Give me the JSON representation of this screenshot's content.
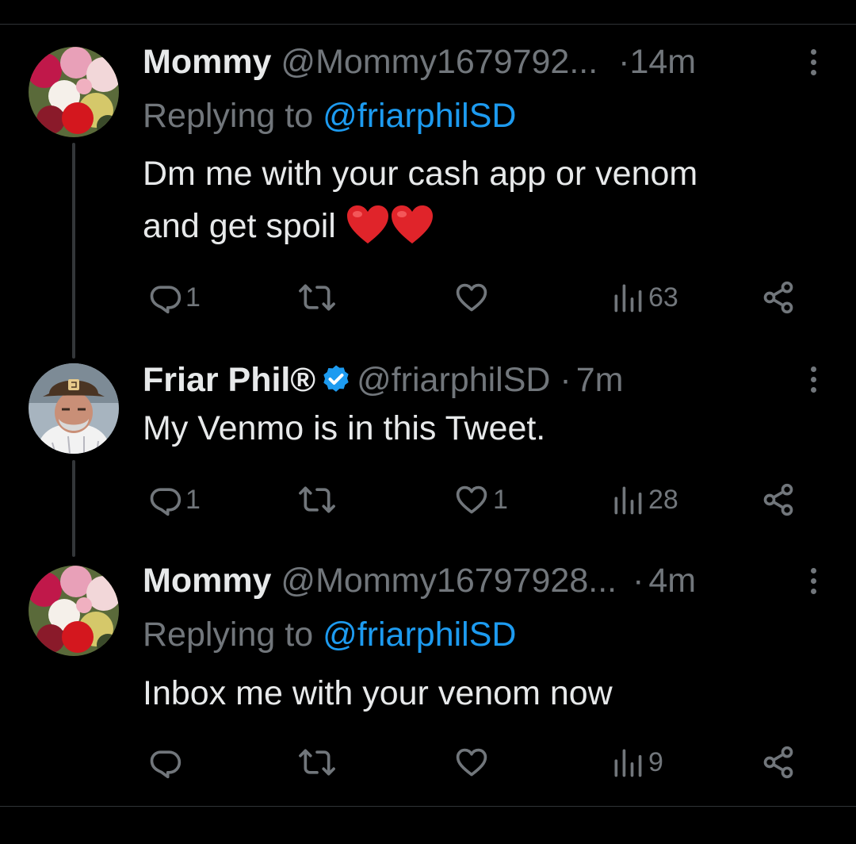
{
  "tweets": [
    {
      "name": "Mommy",
      "handle": "@Mommy1679792...",
      "dot": "·",
      "time": "14m",
      "reply_prefix": "Replying to ",
      "reply_to": "@friarphilSD",
      "text_line1": "Dm me with your cash app or venom",
      "text_line2": "and get spoil ",
      "emoji": [
        "red-heart",
        "red-heart"
      ],
      "reply_count": "1",
      "retweet_count": "",
      "like_count": "",
      "view_count": "63"
    },
    {
      "name": "Friar Phil®",
      "verified": true,
      "handle": "@friarphilSD",
      "dot": "·",
      "time": "7m",
      "text_line1": "My Venmo is in this Tweet.",
      "reply_count": "1",
      "retweet_count": "",
      "like_count": "1",
      "view_count": "28"
    },
    {
      "name": "Mommy",
      "handle": "@Mommy16797928...",
      "dot": "·",
      "time": "4m",
      "reply_prefix": "Replying to ",
      "reply_to": "@friarphilSD",
      "text_line1": "Inbox me with your venom now",
      "reply_count": "",
      "retweet_count": "",
      "like_count": "",
      "view_count": "9"
    }
  ],
  "colors": {
    "background": "#000000",
    "primary_text": "#e7e9ea",
    "secondary_text": "#71767b",
    "mention": "#1d9bf0",
    "verified_badge": "#1d9bf0",
    "divider": "#2f3336"
  },
  "icons": [
    "reply-icon",
    "retweet-icon",
    "like-icon",
    "views-icon",
    "share-icon",
    "more-icon",
    "verified-badge-icon",
    "red-heart-emoji"
  ]
}
